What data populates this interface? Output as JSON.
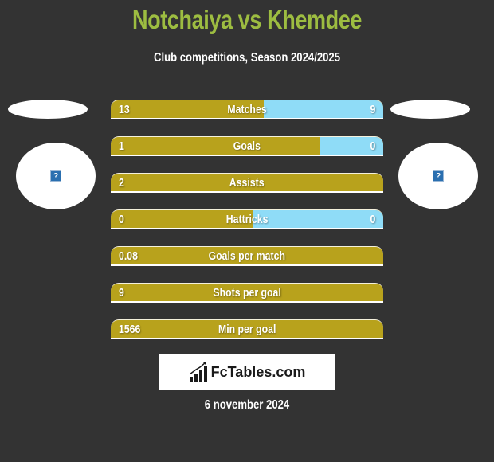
{
  "header": {
    "title": "Notchaiya vs Khemdee",
    "subtitle": "Club competitions, Season 2024/2025"
  },
  "players": {
    "left": {
      "name": "Notchaiya",
      "logo_icon": "question-icon",
      "logo_glyph": "?"
    },
    "right": {
      "name": "Khemdee",
      "logo_icon": "question-icon",
      "logo_glyph": "?"
    }
  },
  "colors": {
    "title": "#9dbd41",
    "left_bar": "#b8a21c",
    "right_bar": "#8fdcf7",
    "background": "#333333"
  },
  "stats": [
    {
      "label": "Matches",
      "left": "13",
      "right": "9",
      "left_fraction": 0.56
    },
    {
      "label": "Goals",
      "left": "1",
      "right": "0",
      "left_fraction": 0.77
    },
    {
      "label": "Assists",
      "left": "2",
      "right": "",
      "left_fraction": 1.0
    },
    {
      "label": "Hattricks",
      "left": "0",
      "right": "0",
      "left_fraction": 0.52
    },
    {
      "label": "Goals per match",
      "left": "0.08",
      "right": "",
      "left_fraction": 1.0
    },
    {
      "label": "Shots per goal",
      "left": "9",
      "right": "",
      "left_fraction": 1.0
    },
    {
      "label": "Min per goal",
      "left": "1566",
      "right": "",
      "left_fraction": 1.0
    }
  ],
  "brand": {
    "name": "FcTables.com",
    "icon": "bar-chart-icon"
  },
  "date": "6 november 2024"
}
